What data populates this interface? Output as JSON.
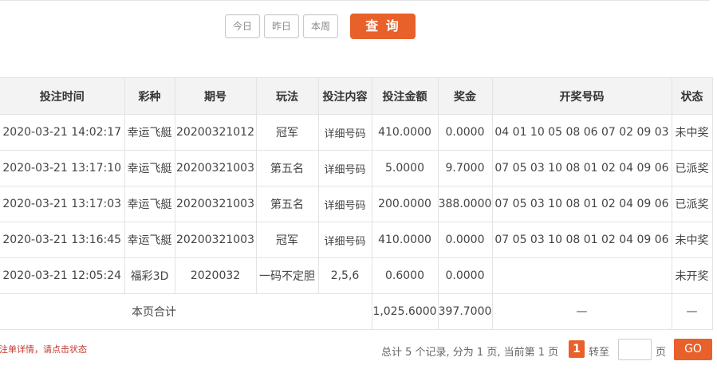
{
  "filters": {
    "today": "今日",
    "yesterday": "昨日",
    "this_week": "本周",
    "query": "查 询"
  },
  "table": {
    "headers": [
      "投注时间",
      "彩种",
      "期号",
      "玩法",
      "投注内容",
      "投注金额",
      "奖金",
      "开奖号码",
      "状态"
    ],
    "rows": [
      {
        "time": "2020-03-21 14:02:17",
        "lottery": "幸运飞艇",
        "issue": "20200321012",
        "play": "冠军",
        "content": "详细号码",
        "amount": "410.0000",
        "prize": "0.0000",
        "draw": "04 01 10 05 08 06 07 02 09 03",
        "status": "未中奖"
      },
      {
        "time": "2020-03-21 13:17:10",
        "lottery": "幸运飞艇",
        "issue": "20200321003",
        "play": "第五名",
        "content": "详细号码",
        "amount": "5.0000",
        "prize": "9.7000",
        "draw": "07 05 03 10 08 01 02 04 09 06",
        "status": "已派奖"
      },
      {
        "time": "2020-03-21 13:17:03",
        "lottery": "幸运飞艇",
        "issue": "20200321003",
        "play": "第五名",
        "content": "详细号码",
        "amount": "200.0000",
        "prize": "388.0000",
        "draw": "07 05 03 10 08 01 02 04 09 06",
        "status": "已派奖"
      },
      {
        "time": "2020-03-21 13:16:45",
        "lottery": "幸运飞艇",
        "issue": "20200321003",
        "play": "冠军",
        "content": "详细号码",
        "amount": "410.0000",
        "prize": "0.0000",
        "draw": "07 05 03 10 08 01 02 04 09 06",
        "status": "未中奖"
      },
      {
        "time": "2020-03-21 12:05:24",
        "lottery": "福彩3D",
        "issue": "2020032",
        "play": "一码不定胆",
        "content": "2,5,6",
        "amount": "0.6000",
        "prize": "0.0000",
        "draw": "",
        "status": "未开奖"
      }
    ],
    "summary": {
      "label": "本页合计",
      "amount": "1,025.6000",
      "prize": "397.7000",
      "draw": "—",
      "status": "—"
    }
  },
  "footer": {
    "hint": "投注单详情，请点击状态",
    "pager_text": "总计 5 个记录, 分为 1 页, 当前第 1 页",
    "current_page": "1",
    "goto_label": "转至",
    "page_unit": "页",
    "go_label": "GO"
  },
  "colors": {
    "accent": "#e8602a",
    "green": "#2a9a2a",
    "header_bg": "#f3f3f3"
  }
}
